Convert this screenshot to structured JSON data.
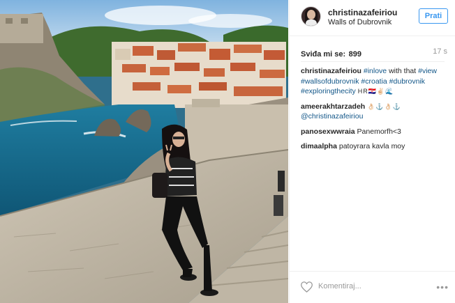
{
  "post": {
    "username": "christinazafeiriou",
    "location": "Walls of Dubrovnik",
    "follow_label": "Prati",
    "likes_label": "Sviđa mi se:",
    "likes_count": "899",
    "time_ago": "17 s"
  },
  "caption": {
    "user": "christinazafeiriou",
    "parts": [
      {
        "text": "#inlove",
        "tag": true
      },
      {
        "text": " with that ",
        "tag": false
      },
      {
        "text": "#view",
        "tag": true
      },
      {
        "text": " ",
        "tag": false
      },
      {
        "text": "#wallsofdubrovnik",
        "tag": true
      },
      {
        "text": " ",
        "tag": false
      },
      {
        "text": "#croatia",
        "tag": true
      },
      {
        "text": " ",
        "tag": false
      },
      {
        "text": "#dubrovnik",
        "tag": true
      },
      {
        "text": " ",
        "tag": false
      },
      {
        "text": "#exploringthecity",
        "tag": true
      }
    ],
    "emoji": "HR🇭🇷✌🏻🌊"
  },
  "comments": [
    {
      "user": "ameerakhtarzadeh",
      "emoji": "👌🏻⚓👌🏻⚓",
      "mention": "@christinazafeiriou",
      "text": ""
    },
    {
      "user": "panosexwwraia",
      "text": "Panemorfh<3"
    },
    {
      "user": "dimaalpha",
      "text": "patoyrara kavla moy"
    }
  ],
  "footer": {
    "comment_placeholder": "Komentiraj...",
    "more_label": "•••"
  },
  "icons": {
    "like": "heart-icon",
    "more": "ellipsis-icon"
  },
  "colors": {
    "link_blue": "#125688",
    "follow_blue": "#3897f0",
    "muted": "#999999"
  }
}
